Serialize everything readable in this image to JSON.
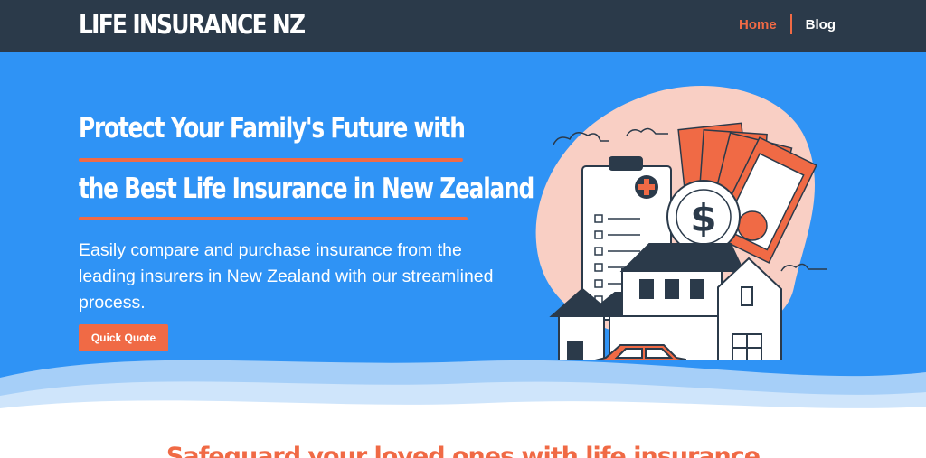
{
  "brand": "LIFE INSURANCE NZ",
  "nav": {
    "home": "Home",
    "blog": "Blog"
  },
  "hero": {
    "headline_line1": "Protect Your Family's Future with",
    "headline_line2": "the Best Life Insurance in New Zealand",
    "subtext": "Easily compare and purchase insurance from the leading insurers in New Zealand with our streamlined process.",
    "cta_label": "Quick Quote"
  },
  "section": {
    "title": "Safeguard your loved ones with life insurance"
  },
  "colors": {
    "navbar": "#2b3a4a",
    "hero_bg": "#2f93f5",
    "accent": "#f06a45",
    "blob": "#f9cfc4",
    "white": "#ffffff"
  },
  "illustration_icons": [
    "clipboard-icon",
    "medical-cross-icon",
    "dollar-coin-icon",
    "banknotes-icon",
    "house-icon",
    "car-icon",
    "cloud-icon",
    "plant-icon"
  ]
}
